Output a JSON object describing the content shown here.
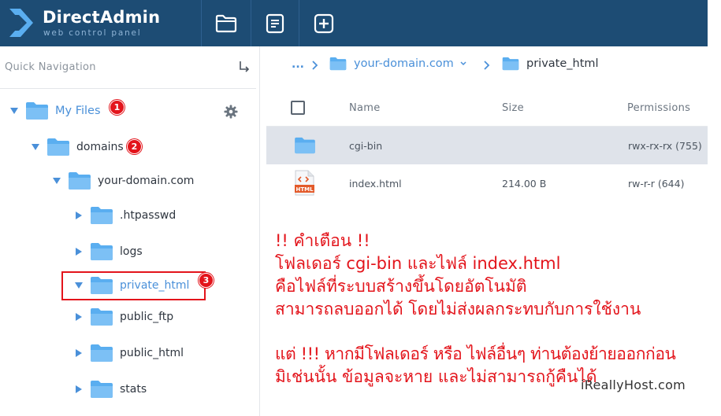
{
  "header": {
    "logo_title": "DirectAdmin",
    "logo_subtitle": "web control panel",
    "icons": [
      "folder-icon",
      "document-icon",
      "plus-square-icon"
    ]
  },
  "sidebar": {
    "quick_nav_label": "Quick Navigation",
    "tree": [
      {
        "label": "My Files",
        "expanded": true,
        "badge": "1"
      },
      {
        "label": "domains",
        "expanded": true,
        "badge": "2"
      },
      {
        "label": "your-domain.com",
        "expanded": true
      },
      {
        "label": ".htpasswd",
        "expanded": false
      },
      {
        "label": "logs",
        "expanded": false
      },
      {
        "label": "private_html",
        "expanded": true,
        "badge": "3"
      },
      {
        "label": "public_ftp",
        "expanded": false
      },
      {
        "label": "public_html",
        "expanded": false
      },
      {
        "label": "stats",
        "expanded": false
      }
    ]
  },
  "breadcrumb": {
    "ellipsis": "...",
    "items": [
      "your-domain.com",
      "private_html"
    ]
  },
  "table": {
    "headers": {
      "name": "Name",
      "size": "Size",
      "permissions": "Permissions"
    },
    "rows": [
      {
        "name": "cgi-bin",
        "size": "",
        "permissions": "rwx-rx-rx (755)",
        "type": "folder",
        "selected": true
      },
      {
        "name": "index.html",
        "size": "214.00 B",
        "permissions": "rw-r-r (644)",
        "type": "html",
        "file_badge": "HTML"
      }
    ]
  },
  "warning": {
    "lines": [
      "!! คำเตือน !!",
      "โฟลเดอร์ cgi-bin และไฟล์ index.html",
      "คือไฟล์ที่ระบบสร้างขึ้นโดยอัตโนมัติ",
      "สามารถลบออกได้ โดยไม่ส่งผลกระทบกับการใช้งาน",
      "แต่ !!! หากมีโฟลเดอร์ หรือ ไฟล์อื่นๆ ท่านต้องย้ายออกก่อน",
      "มิเช่นนั้น ข้อมูลจะหาย และไม่สามารถกู้คืนได้"
    ]
  },
  "watermark": "iReallyHost.com",
  "colors": {
    "header_bg": "#1d4c74",
    "accent": "#4a90d9",
    "folder": "#5aaef0",
    "warning": "#e3141b",
    "selected_row": "#dfe3ea"
  }
}
